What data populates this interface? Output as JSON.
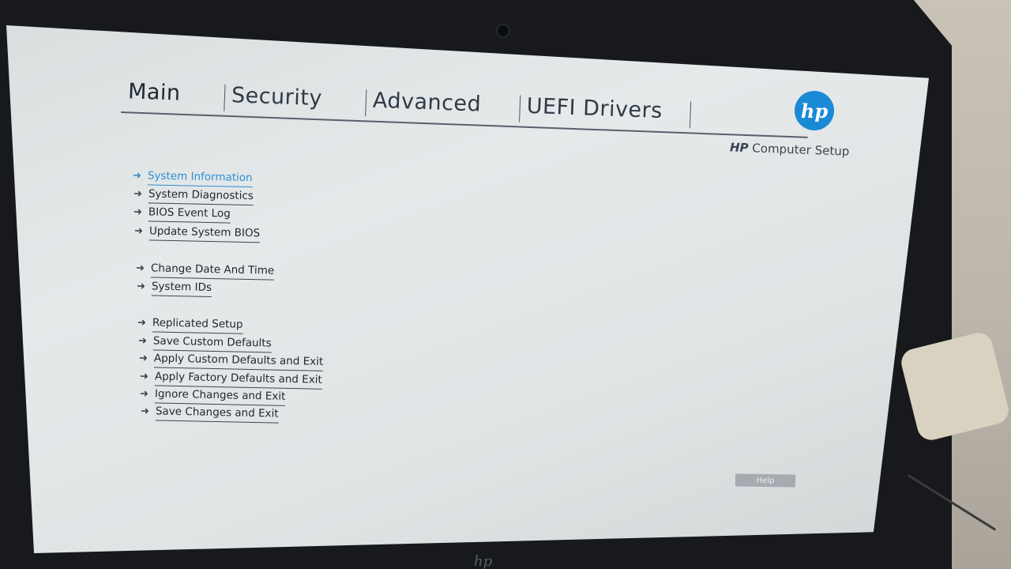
{
  "tabs": [
    {
      "label": "Main"
    },
    {
      "label": "Security"
    },
    {
      "label": "Advanced"
    },
    {
      "label": "UEFI Drivers"
    }
  ],
  "brand": {
    "logo_text": "hp",
    "setup_title_bold": "HP",
    "setup_title_rest": " Computer Setup",
    "bezel_logo": "hp"
  },
  "menu": {
    "group1": [
      {
        "label": "System Information"
      },
      {
        "label": "System Diagnostics"
      },
      {
        "label": "BIOS Event Log"
      },
      {
        "label": "Update System BIOS"
      }
    ],
    "group2": [
      {
        "label": "Change Date And Time"
      },
      {
        "label": "System IDs"
      }
    ],
    "group3": [
      {
        "label": "Replicated Setup"
      },
      {
        "label": "Save Custom Defaults"
      },
      {
        "label": "Apply Custom Defaults and Exit"
      },
      {
        "label": "Apply Factory Defaults and Exit"
      },
      {
        "label": "Ignore Changes and Exit"
      },
      {
        "label": "Save Changes and Exit"
      }
    ],
    "arrow_icon": "right-arrow-icon"
  },
  "help_button": {
    "label": "Help"
  },
  "colors": {
    "accent": "#2c8fd2",
    "hp_blue": "#1b8ad6"
  }
}
